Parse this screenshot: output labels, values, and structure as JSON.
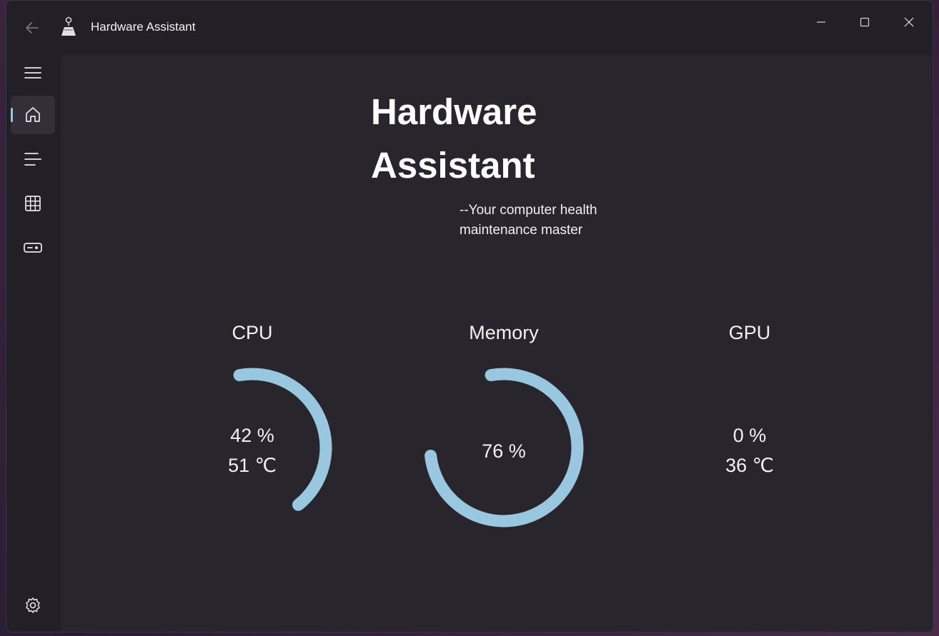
{
  "app": {
    "title": "Hardware Assistant"
  },
  "window_controls": {
    "icons": [
      "minimize-icon",
      "maximize-icon",
      "close-icon"
    ]
  },
  "nav": {
    "items": [
      {
        "icon": "hamburger-menu-icon"
      },
      {
        "icon": "home-icon",
        "selected": true
      },
      {
        "icon": "list-icon"
      },
      {
        "icon": "grid-icon"
      },
      {
        "icon": "device-icon"
      }
    ],
    "footer_icon": "gear-icon"
  },
  "hero": {
    "title_line1": "Hardware",
    "title_line2": "Assistant",
    "subtitle_line1": "--Your computer health",
    "subtitle_line2": "maintenance master"
  },
  "gauges": [
    {
      "label": "CPU",
      "usage": "42 %",
      "temp": "51 ℃",
      "percent": 42
    },
    {
      "label": "Memory",
      "usage": "76 %",
      "percent": 76
    },
    {
      "label": "GPU",
      "usage": "0 %",
      "temp": "36 ℃",
      "percent": 0
    }
  ],
  "colors": {
    "accent": "#9ac7e0",
    "window_bg": "#231f27",
    "content_bg": "#29252d"
  }
}
